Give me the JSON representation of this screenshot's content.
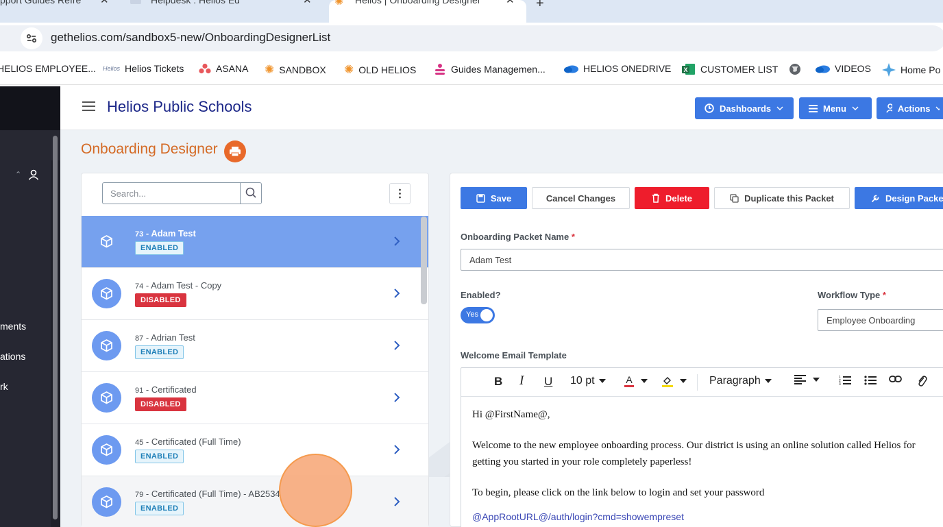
{
  "browser": {
    "tabs": [
      {
        "label": "pport Guides Refre"
      },
      {
        "label": "Helpdesk : Helios Ed"
      },
      {
        "label": "Helios | Onboarding Designer"
      }
    ],
    "new_tab_glyph": "+",
    "close_glyph": "✕",
    "url": "gethelios.com/sandbox5-new/OnboardingDesignerList",
    "bookmarks": [
      {
        "label": "HELIOS EMPLOYEE...",
        "icon": "helios-icon"
      },
      {
        "label": "Helios Tickets",
        "icon": "helios-logo-icon"
      },
      {
        "label": "ASANA",
        "icon": "asana-icon",
        "color": "#e8575b"
      },
      {
        "label": "SANDBOX",
        "icon": "sun-icon",
        "color": "#f0932b"
      },
      {
        "label": "OLD HELIOS",
        "icon": "sun-icon",
        "color": "#f0932b"
      },
      {
        "label": "Guides Managemen...",
        "icon": "guides-icon",
        "color": "#d63384"
      },
      {
        "label": "HELIOS ONEDRIVE",
        "icon": "onedrive-icon",
        "color": "#2a7de1"
      },
      {
        "label": "CUSTOMER LIST",
        "icon": "excel-icon",
        "color": "#1e7145"
      },
      {
        "label": "",
        "icon": "globe-icon"
      },
      {
        "label": "VIDEOS",
        "icon": "onedrive-icon",
        "color": "#2a7de1"
      },
      {
        "label": "Home Po",
        "icon": "sparkle-icon",
        "color": "#4fa3e0"
      }
    ]
  },
  "sidebar": {
    "items": [
      {
        "label": "ments"
      },
      {
        "label": "ations"
      },
      {
        "label": "rk"
      }
    ]
  },
  "header": {
    "school_name": "Helios Public Schools",
    "buttons": [
      {
        "label": "Dashboards",
        "icon": "dashboard-icon"
      },
      {
        "label": "Menu",
        "icon": "menu-icon"
      },
      {
        "label": "Actions",
        "icon": "user-plus-icon"
      }
    ]
  },
  "page": {
    "title": "Onboarding Designer"
  },
  "list": {
    "search_placeholder": "Search...",
    "items": [
      {
        "num": "73",
        "name": "Adam Test",
        "status": "ENABLED",
        "selected": true
      },
      {
        "num": "74",
        "name": "Adam Test - Copy",
        "status": "DISABLED"
      },
      {
        "num": "87",
        "name": "Adrian Test",
        "status": "ENABLED"
      },
      {
        "num": "91",
        "name": "Certificated",
        "status": "DISABLED"
      },
      {
        "num": "45",
        "name": "Certificated (Full Time)",
        "status": "ENABLED"
      },
      {
        "num": "79",
        "name": "Certificated (Full Time) - AB2534",
        "status": "ENABLED"
      }
    ]
  },
  "form": {
    "actions": {
      "save": "Save",
      "cancel": "Cancel Changes",
      "delete": "Delete",
      "duplicate": "Duplicate this Packet",
      "design": "Design Packet"
    },
    "packet_name_label": "Onboarding Packet Name",
    "packet_name_value": "Adam Test",
    "required_mark": "*",
    "enabled_label": "Enabled?",
    "enabled_value": "Yes",
    "workflow_label": "Workflow Type",
    "workflow_value": "Employee Onboarding",
    "email_label": "Welcome Email Template",
    "editor": {
      "font_size": "10 pt",
      "block_format": "Paragraph",
      "text_color": "#d9343f",
      "highlight_color": "#f5d90a",
      "lines": [
        "Hi @FirstName@,",
        "Welcome to the new employee onboarding process. Our district is using an online solution called Helios for",
        "getting you started in your role completely paperless!",
        "To begin, please click on the link below to login and set your password"
      ],
      "link": "@AppRootURL@/auth/login?cmd=showempreset"
    }
  }
}
